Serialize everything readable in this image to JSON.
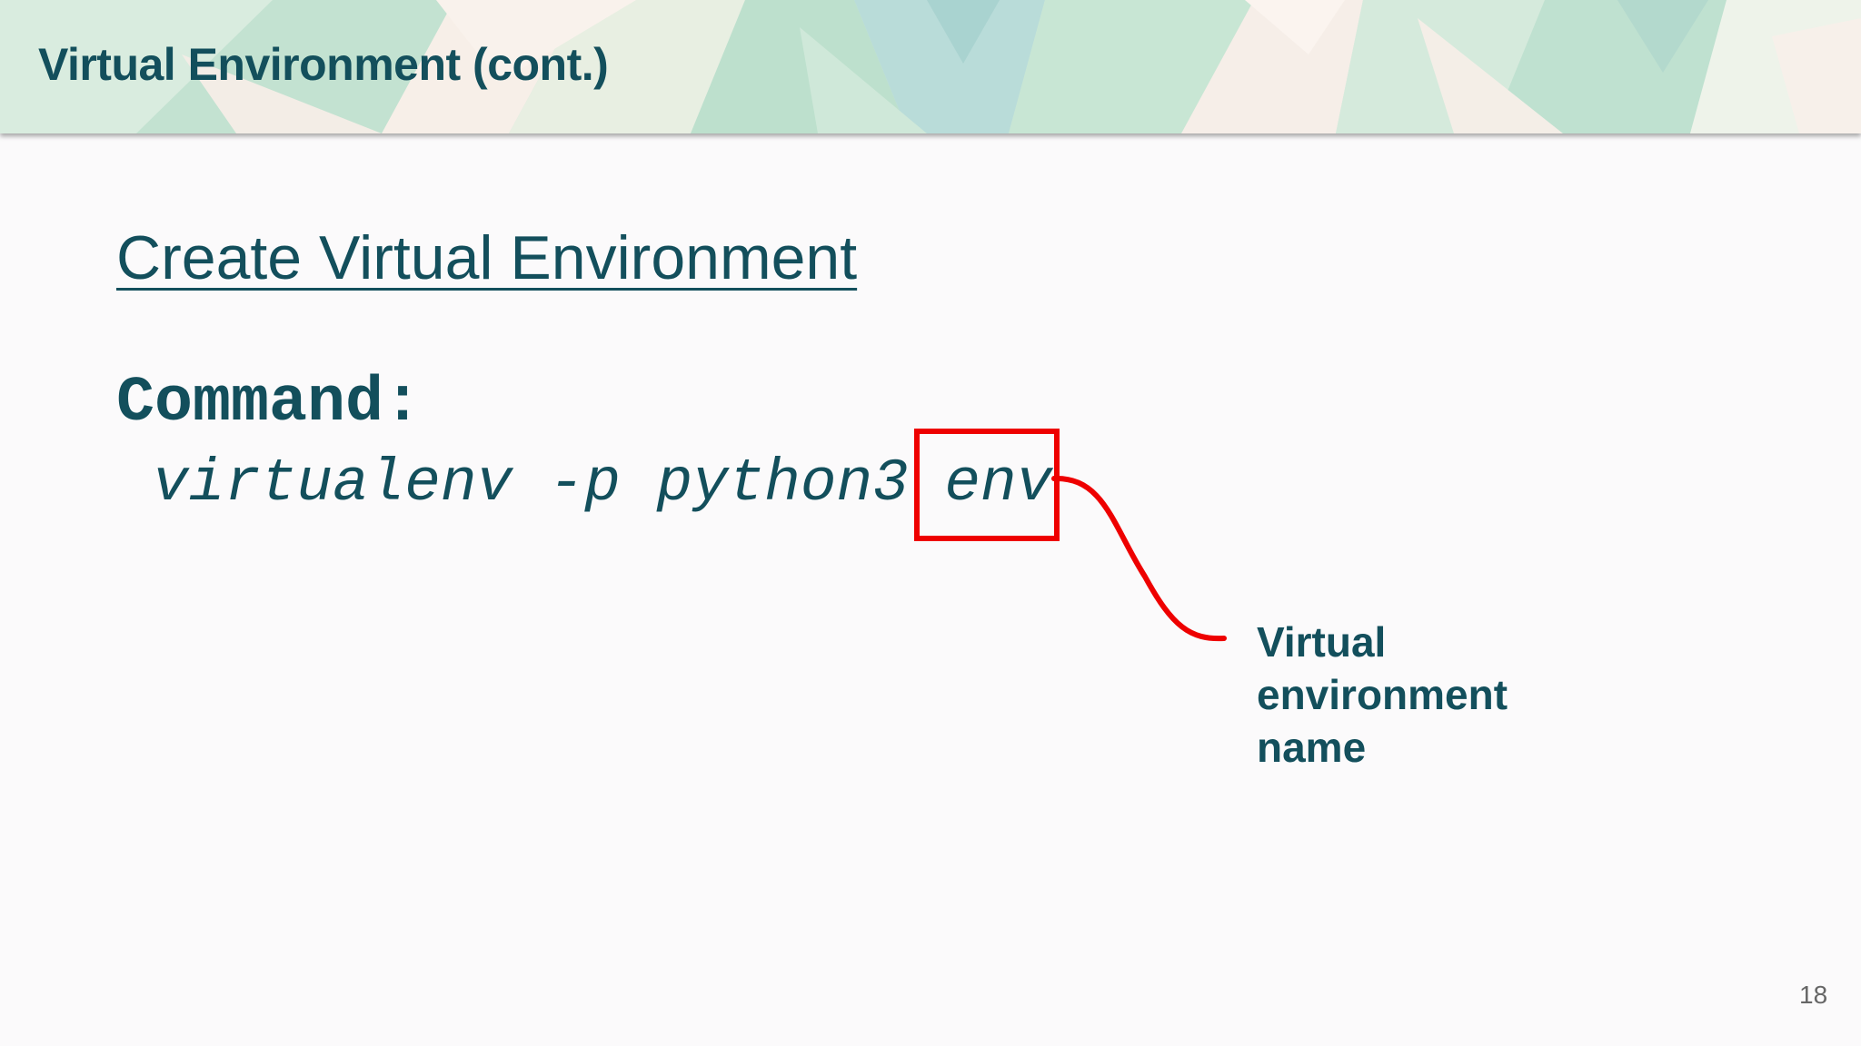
{
  "slide": {
    "title": "Virtual Environment (cont.)",
    "subtitle": "Create Virtual Environment",
    "command_label": "Command:",
    "command_prefix": "virtualenv -p python3 ",
    "command_arg": "env",
    "annotation_lines": [
      "Virtual",
      "environment",
      "name"
    ],
    "page_number": "18"
  },
  "colors": {
    "text": "#134f5c",
    "highlight": "#ee0000",
    "background": "#fbfafb"
  }
}
